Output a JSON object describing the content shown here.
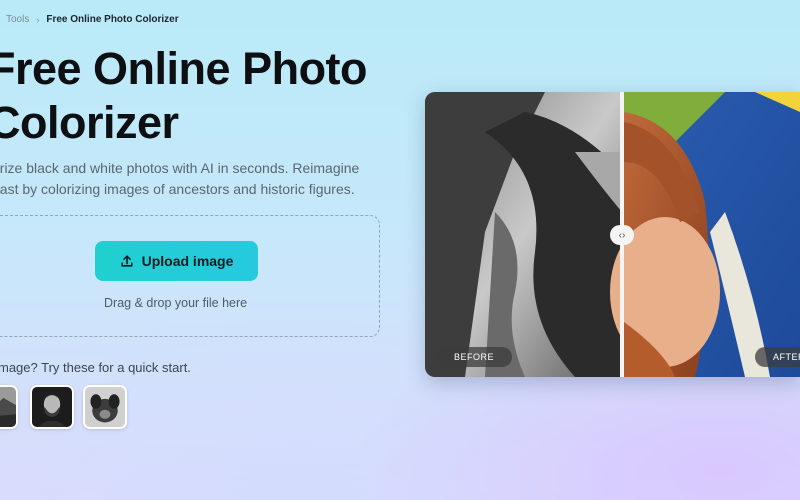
{
  "breadcrumb": {
    "sep": "›",
    "items": [
      "Tools",
      "Free Online Photo Colorizer"
    ]
  },
  "hero": {
    "title_line1": "Free Online Photo",
    "title_line2": "Colorizer",
    "subtitle_line1": "orize black and white photos with AI in seconds. Reimagine",
    "subtitle_line2": "past by colorizing images of ancestors and historic figures."
  },
  "upload": {
    "button_label": "Upload image",
    "drag_text": "Drag & drop your file here",
    "icon": "upload-icon"
  },
  "samples": {
    "prompt": "mage? Try these for a quick start.",
    "thumbnails": [
      "sample-landscape",
      "sample-man-portrait",
      "sample-dog"
    ]
  },
  "compare": {
    "before_label": "BEFORE",
    "after_label": "AFTER",
    "handle_icon": "‹›"
  },
  "colors": {
    "button": "#22cdd6",
    "background_top": "#b9eaf7",
    "background_bottom": "#dcdcfb"
  }
}
